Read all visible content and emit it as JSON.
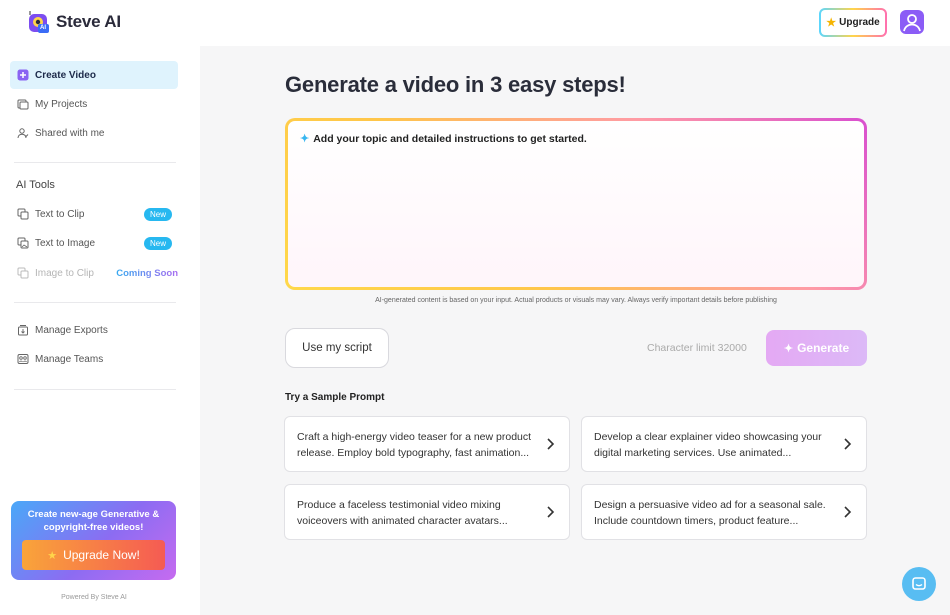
{
  "header": {
    "app_name": "Steve AI",
    "logo_badge": "AI",
    "upgrade_label": "Upgrade",
    "upgrade_icon": "star-icon",
    "avatar_icon": "user-icon"
  },
  "sidebar": {
    "items": [
      {
        "label": "Create Video",
        "icon": "plus-square-icon",
        "active": true
      },
      {
        "label": "My Projects",
        "icon": "folder-icon"
      },
      {
        "label": "Shared with me",
        "icon": "users-icon"
      }
    ],
    "ai_tools_title": "AI Tools",
    "tools": [
      {
        "label": "Text to Clip",
        "icon": "clip-icon",
        "badge": "New"
      },
      {
        "label": "Text to Image",
        "icon": "image-icon",
        "badge": "New"
      },
      {
        "label": "Image to Clip",
        "icon": "image-clip-icon",
        "status": "Coming Soon"
      }
    ],
    "manage": [
      {
        "label": "Manage Exports",
        "icon": "export-icon"
      },
      {
        "label": "Manage Teams",
        "icon": "team-icon"
      }
    ],
    "promo": {
      "text": "Create new-age Generative & copyright-free videos!",
      "button_label": "Upgrade Now!"
    },
    "powered_by": "Powered By Steve AI"
  },
  "main": {
    "title": "Generate a video in 3 easy steps!",
    "prompt_placeholder": "Add your topic and detailed instructions to get started.",
    "disclaimer": "AI-generated content is based on your input. Actual products or visuals may vary. Always verify important details before publishing",
    "script_button": "Use my script",
    "char_limit": "Character limit 32000",
    "generate_button": "Generate",
    "sample_title": "Try a Sample Prompt",
    "samples": [
      {
        "text": "Craft a high-energy video teaser for a new product release. Employ bold typography, fast animation..."
      },
      {
        "text": "Develop a clear explainer video showcasing your digital marketing services. Use animated..."
      },
      {
        "text": "Produce a faceless testimonial video mixing voiceovers with animated character avatars..."
      },
      {
        "text": "Design a persuasive video ad for a seasonal sale. Include countdown timers, product feature..."
      }
    ]
  },
  "colors": {
    "accent": "#27b8f0",
    "active_bg": "#dff3fd",
    "generate": "#e4a9f4",
    "promo": "#8c6cf2"
  }
}
